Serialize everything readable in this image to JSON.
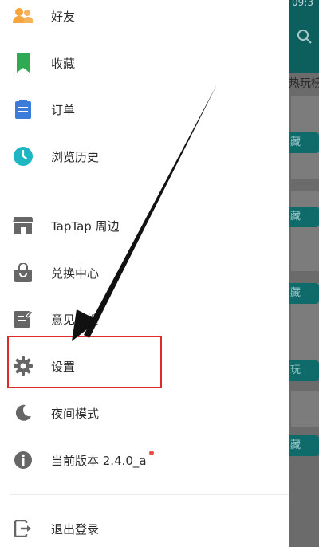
{
  "status_bar": {
    "time": "09:3"
  },
  "background": {
    "hot_text": "热玩榜",
    "chips": [
      "藏",
      "藏",
      "藏",
      "玩",
      "藏"
    ]
  },
  "drawer": {
    "menu_items": [
      {
        "label": "好友",
        "icon": "friends-icon"
      },
      {
        "label": "收藏",
        "icon": "bookmark-icon"
      },
      {
        "label": "订单",
        "icon": "order-icon"
      },
      {
        "label": "浏览历史",
        "icon": "history-clock-icon"
      },
      {
        "label": "TapTap 周边",
        "icon": "store-icon"
      },
      {
        "label": "兑换中心",
        "icon": "shopping-bag-icon"
      },
      {
        "label": "意见反馈",
        "icon": "feedback-edit-icon"
      },
      {
        "label": "设置",
        "icon": "gear-icon"
      },
      {
        "label": "夜间模式",
        "icon": "moon-icon"
      },
      {
        "label": "当前版本 2.4.0_a",
        "icon": "info-icon",
        "has_badge_dot": true
      },
      {
        "label": "退出登录",
        "icon": "logout-icon"
      }
    ]
  },
  "colors": {
    "accent_teal": "#0d5f5e",
    "friends_orange": "#f5a53b",
    "bookmark_green": "#2eaa52",
    "order_blue": "#3d7bd9",
    "history_teal": "#1fb6c4",
    "icon_gray": "#666666",
    "highlight_red": "#e02a2a",
    "badge_red": "#ee4b4b"
  }
}
